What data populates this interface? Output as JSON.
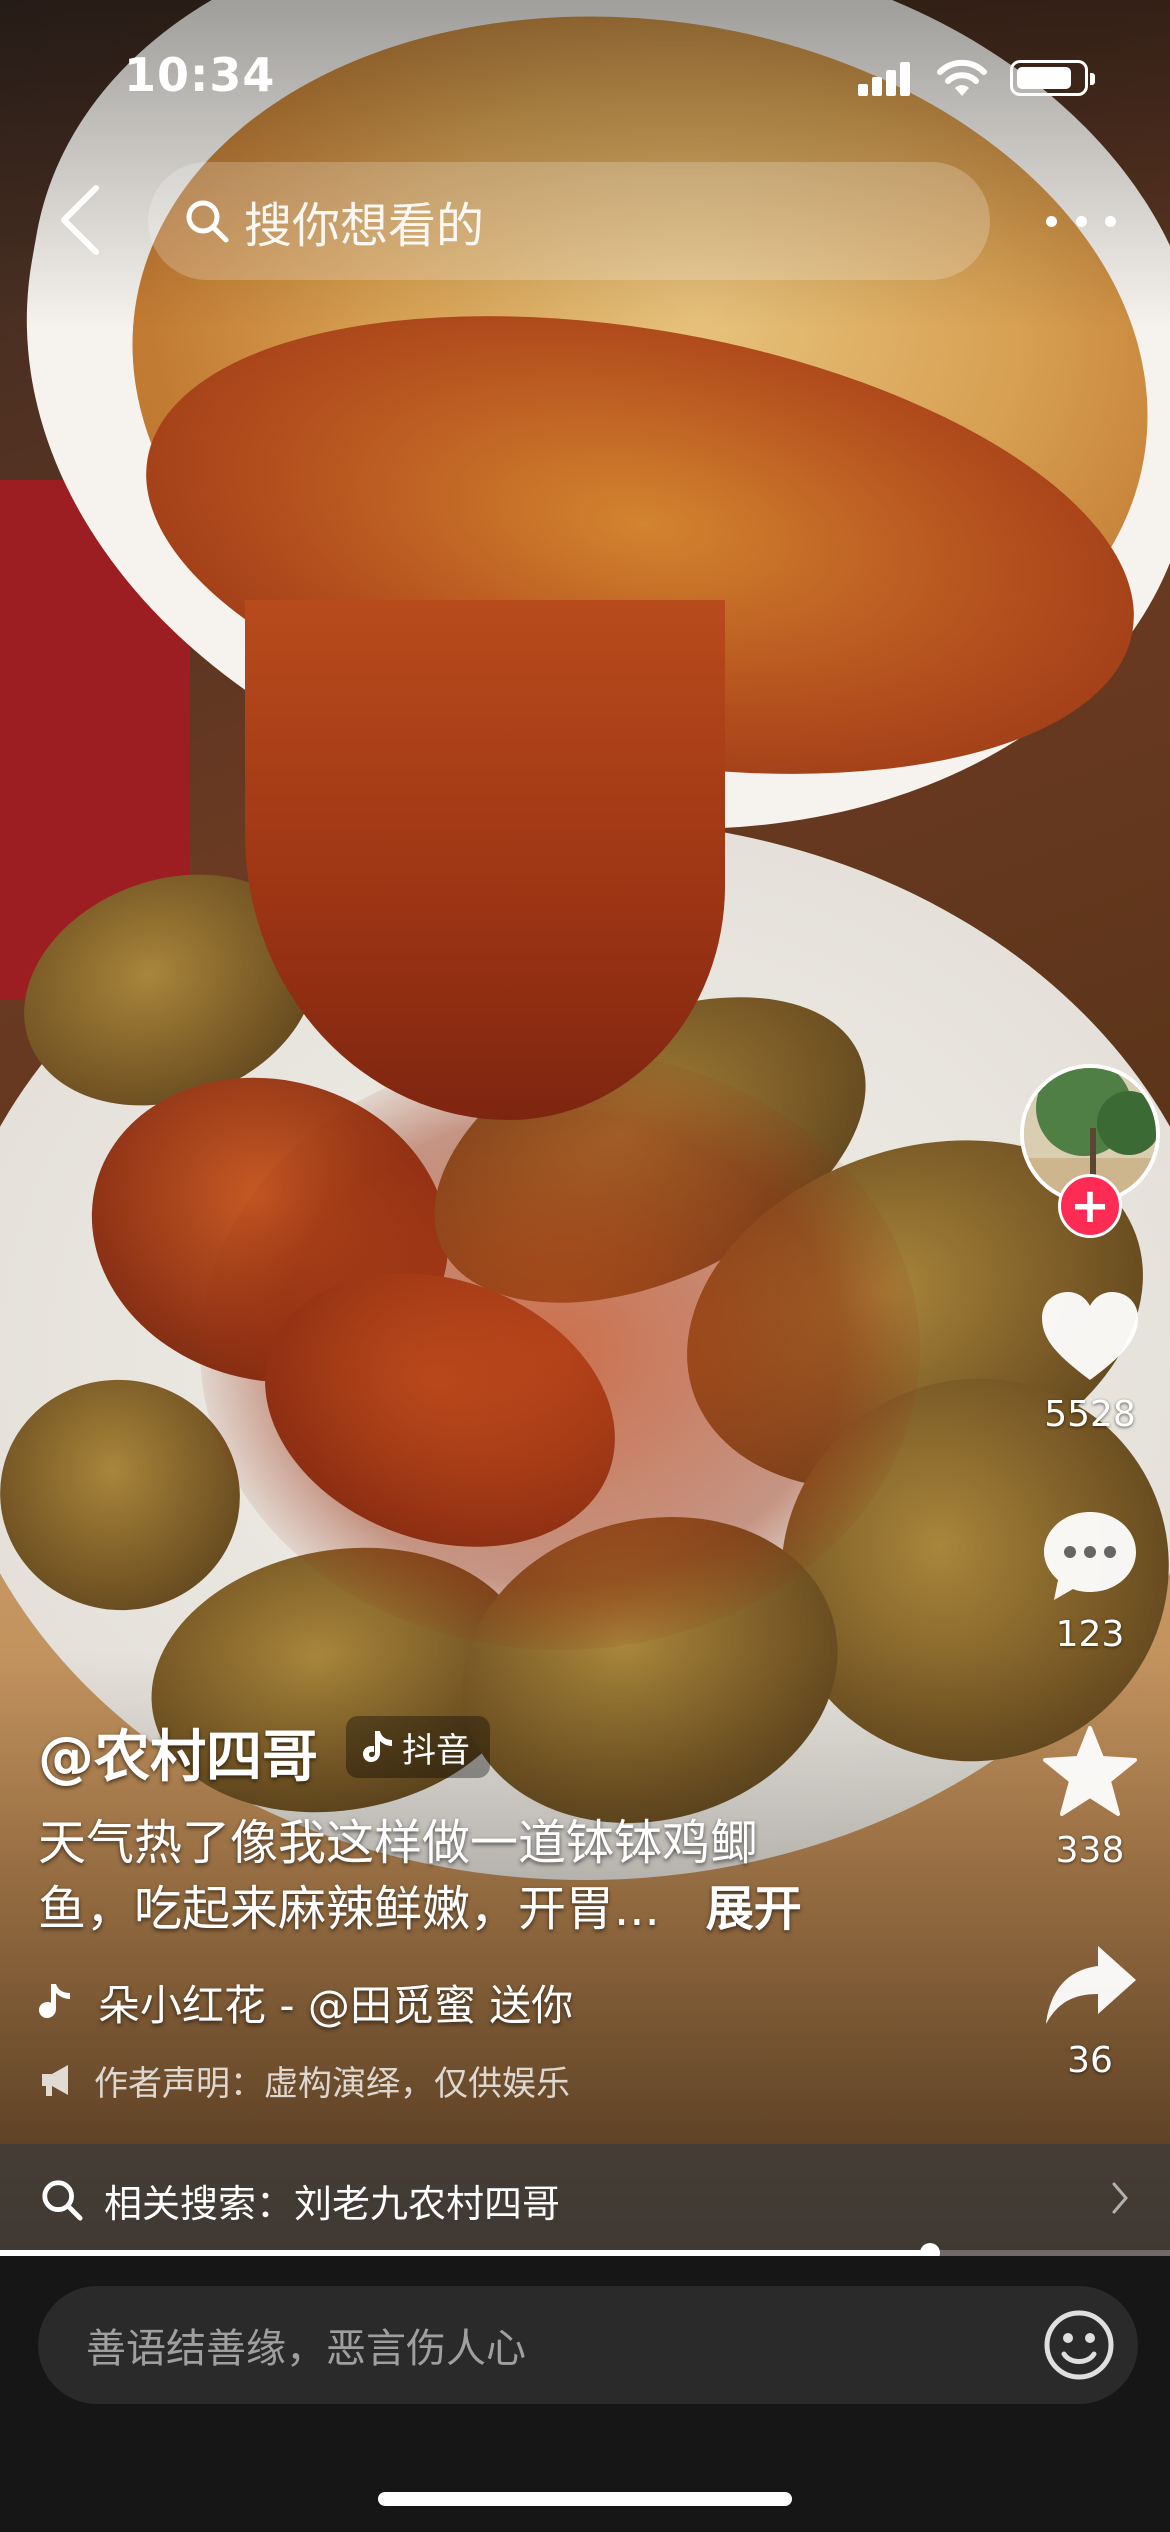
{
  "status_bar": {
    "time": "10:34",
    "battery_level": 0.85
  },
  "search": {
    "placeholder": "搜你想看的"
  },
  "video": {
    "author": "@农村四哥",
    "platform_badge": "抖音",
    "caption_line1": "天气热了像我这样做一道钵钵鸡鲫",
    "caption_line2": "鱼，吃起来麻辣鲜嫩，开胃...",
    "expand_label": "展开",
    "music_text": "朵小红花 - @田觅蜜   送你",
    "declaration": "作者声明：虚构演绎，仅供娱乐",
    "progress": 0.795
  },
  "actions": {
    "likes": "5528",
    "comments": "123",
    "favorites": "338",
    "shares": "36"
  },
  "related_search": {
    "text": "相关搜索：刘老九农村四哥"
  },
  "comment_input": {
    "placeholder": "善语结善缘，恶言伤人心"
  },
  "icons": {
    "back": "back-arrow-icon",
    "search": "search-icon",
    "more": "more-dots-icon",
    "like": "heart-icon",
    "comment": "comment-bubble-icon",
    "favorite": "star-icon",
    "share": "share-arrow-icon",
    "music": "music-note-icon",
    "declare": "megaphone-icon",
    "emoji": "emoji-icon"
  },
  "colors": {
    "follow": "#fe2c55",
    "bottom_bar": "#161616"
  }
}
